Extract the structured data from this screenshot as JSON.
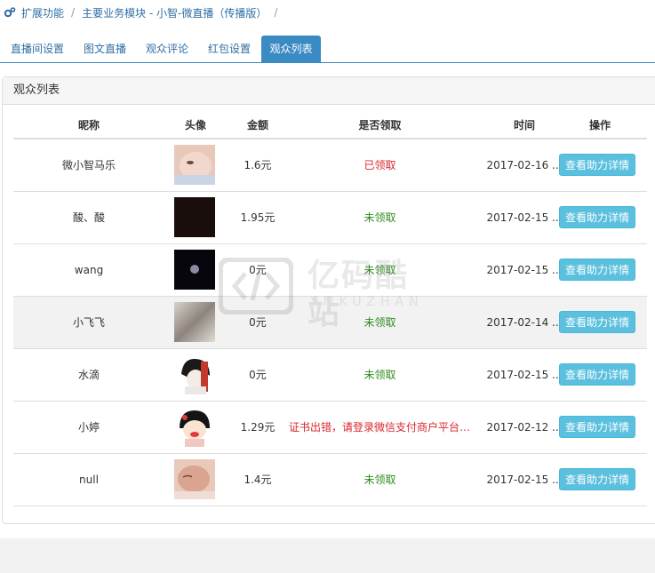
{
  "breadcrumb": {
    "items": [
      "扩展功能",
      "主要业务模块 - 小智-微直播（传播版）"
    ],
    "separator": "/"
  },
  "tabs": [
    {
      "label": "直播间设置",
      "active": false
    },
    {
      "label": "图文直播",
      "active": false
    },
    {
      "label": "观众评论",
      "active": false
    },
    {
      "label": "红包设置",
      "active": false
    },
    {
      "label": "观众列表",
      "active": true
    }
  ],
  "panel": {
    "title": "观众列表"
  },
  "table": {
    "headers": [
      "昵称",
      "头像",
      "金额",
      "是否领取",
      "时间",
      "操作"
    ],
    "rows": [
      {
        "nick": "微小智马乐",
        "amount": "1.6元",
        "status": "已领取",
        "status_type": "red",
        "time": "2017-02-16 ...",
        "action": "查看助力详情",
        "avatar_icon": "baby-photo"
      },
      {
        "nick": "酸、酸",
        "amount": "1.95元",
        "status": "未领取",
        "status_type": "green",
        "time": "2017-02-15 ...",
        "action": "查看助力详情",
        "avatar_icon": "dark-photo"
      },
      {
        "nick": "wang",
        "amount": "0元",
        "status": "未领取",
        "status_type": "green",
        "time": "2017-02-15 ...",
        "action": "查看助力详情",
        "avatar_icon": "moon-photo"
      },
      {
        "nick": "小飞飞",
        "amount": "0元",
        "status": "未领取",
        "status_type": "green",
        "time": "2017-02-14 ...",
        "action": "查看助力详情",
        "avatar_icon": "blur-photo"
      },
      {
        "nick": "水滴",
        "amount": "0元",
        "status": "未领取",
        "status_type": "green",
        "time": "2017-02-15 ...",
        "action": "查看助力详情",
        "avatar_icon": "anime-photo"
      },
      {
        "nick": "小婷",
        "amount": "1.29元",
        "status": "证书出错，请登录微信支付商户平台下...",
        "status_type": "red",
        "time": "2017-02-12 ...",
        "action": "查看助力详情",
        "avatar_icon": "cartoon-girl-photo"
      },
      {
        "nick": "null",
        "amount": "1.4元",
        "status": "未领取",
        "status_type": "green",
        "time": "2017-02-15 ...",
        "action": "查看助力详情",
        "avatar_icon": "sleeping-baby-photo"
      }
    ]
  },
  "watermark": {
    "title": "亿码酷站",
    "subtitle": "YMKUZHAN"
  },
  "colors": {
    "accent": "#3a8ac4",
    "button": "#5bc0de",
    "green": "#2e8b1e",
    "red": "#d9272e"
  }
}
